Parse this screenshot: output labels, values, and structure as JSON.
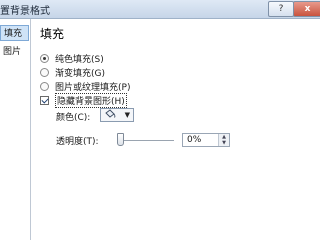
{
  "window": {
    "title": "置背景格式",
    "help_label": "?",
    "close_label": "x"
  },
  "nav": {
    "items": [
      {
        "label": "填充"
      },
      {
        "label": "图片"
      }
    ]
  },
  "fill": {
    "section_title": "填充",
    "options": [
      {
        "label": "纯色填充(S)",
        "checked": true
      },
      {
        "label": "渐变填充(G)",
        "checked": false
      },
      {
        "label": "图片或纹理填充(P)",
        "checked": false
      }
    ],
    "hide_background_label": "隐藏背景图形(H)",
    "hide_background_checked": true,
    "color_label": "颜色(C):",
    "transparency_label": "透明度(T):",
    "transparency_value": "0%",
    "transparency_level": 0
  },
  "icons": {
    "bucket": "paint-bucket-icon",
    "caret": "chevron-down-icon",
    "spin": "spin-arrows-icon"
  }
}
